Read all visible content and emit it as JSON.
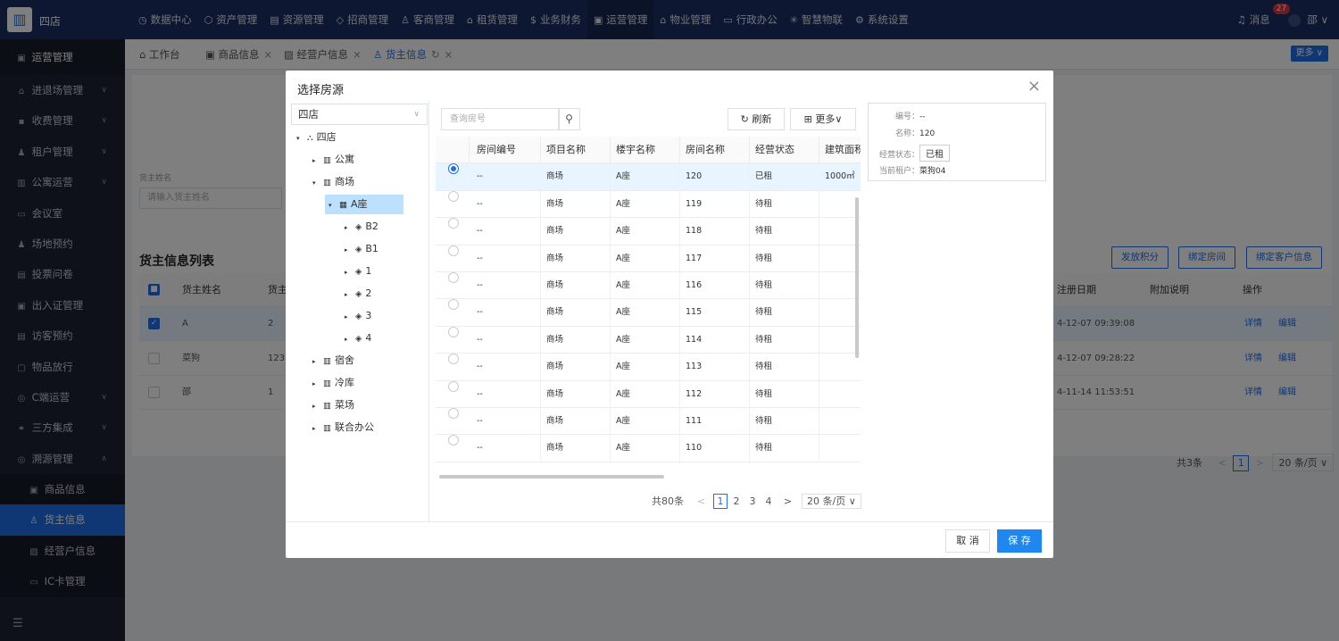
{
  "app": {
    "name": "四店",
    "logo_icon": "building-icon"
  },
  "topnav": [
    {
      "icon": "◷",
      "label": "数据中心",
      "active": false
    },
    {
      "icon": "⬡",
      "label": "资产管理",
      "active": false
    },
    {
      "icon": "▤",
      "label": "资源管理",
      "active": false
    },
    {
      "icon": "◇",
      "label": "招商管理",
      "active": false
    },
    {
      "icon": "♙",
      "label": "客商管理",
      "active": false
    },
    {
      "icon": "⌂",
      "label": "租赁管理",
      "active": false
    },
    {
      "icon": "$",
      "label": "业务财务",
      "active": false
    },
    {
      "icon": "▣",
      "label": "运营管理",
      "active": true
    },
    {
      "icon": "⌂",
      "label": "物业管理",
      "active": false
    },
    {
      "icon": "▭",
      "label": "行政办公",
      "active": false
    },
    {
      "icon": "✳",
      "label": "智慧物联",
      "active": false
    },
    {
      "icon": "⚙",
      "label": "系统设置",
      "active": false
    }
  ],
  "header": {
    "messages_label": "消息",
    "messages_count": "27",
    "user_name": "邵"
  },
  "sidebar": {
    "section_title": "运营管理",
    "items": [
      {
        "label": "进退场管理",
        "icon": "⌂",
        "has_arrow": true
      },
      {
        "label": "收费管理",
        "icon": "▪",
        "has_arrow": true
      },
      {
        "label": "租户管理",
        "icon": "♟",
        "has_arrow": true
      },
      {
        "label": "公寓运营",
        "icon": "▥",
        "has_arrow": true
      },
      {
        "label": "会议室",
        "icon": "▭",
        "has_arrow": false
      },
      {
        "label": "场地预约",
        "icon": "♟",
        "has_arrow": false
      },
      {
        "label": "投票问卷",
        "icon": "▤",
        "has_arrow": false
      },
      {
        "label": "出入证管理",
        "icon": "▣",
        "has_arrow": false
      },
      {
        "label": "访客预约",
        "icon": "▤",
        "has_arrow": false
      },
      {
        "label": "物品放行",
        "icon": "▢",
        "has_arrow": false
      },
      {
        "label": "C端运营",
        "icon": "◎",
        "has_arrow": true
      },
      {
        "label": "三方集成",
        "icon": "⚭",
        "has_arrow": true
      },
      {
        "label": "溯源管理",
        "icon": "◎",
        "has_arrow": true,
        "expanded": true
      }
    ],
    "sub_items": [
      {
        "label": "商品信息",
        "icon": "▣",
        "selected": false
      },
      {
        "label": "货主信息",
        "icon": "♙",
        "selected": true
      },
      {
        "label": "经营户信息",
        "icon": "▨",
        "selected": false
      },
      {
        "label": "IC卡管理",
        "icon": "▭",
        "selected": false
      }
    ]
  },
  "tabs": [
    {
      "icon": "⌂",
      "label": "工作台",
      "closable": false,
      "active": false
    },
    {
      "icon": "▣",
      "label": "商品信息",
      "closable": true,
      "active": false
    },
    {
      "icon": "▨",
      "label": "经营户信息",
      "closable": true,
      "active": false
    },
    {
      "icon": "♙",
      "label": "货主信息",
      "closable": true,
      "active": true,
      "refresh": "↻"
    }
  ],
  "tabs_more": "更多 ∨",
  "filter": {
    "label": "货主姓名",
    "placeholder": "请输入货主姓名"
  },
  "owner_list": {
    "title": "货主信息列表",
    "buttons": [
      "发放积分",
      "绑定房间",
      "绑定客户信息"
    ],
    "columns": [
      "货主姓名",
      "货主",
      "注册日期",
      "附加说明",
      "操作"
    ],
    "rows": [
      {
        "name": "A",
        "col2": "2",
        "date": "4-12-07 09:39:08",
        "selected": true
      },
      {
        "name": "菜狗",
        "col2": "123",
        "date": "4-12-07 09:28:22",
        "selected": false
      },
      {
        "name": "邵",
        "col2": "1",
        "date": "4-11-14 11:53:51",
        "selected": false
      }
    ],
    "action_detail": "详情",
    "action_edit": "编辑",
    "total": "共3条",
    "page": "1",
    "page_size": "20 条/页 ∨"
  },
  "modal": {
    "title": "选择房源",
    "tree_select": "四店",
    "tree": [
      {
        "label": "四店",
        "level": 0,
        "caret": "▾",
        "icon": "⛬",
        "selected": false
      },
      {
        "label": "公寓",
        "level": 1,
        "caret": "▸",
        "icon": "▥",
        "selected": false
      },
      {
        "label": "商场",
        "level": 1,
        "caret": "▾",
        "icon": "▥",
        "selected": false
      },
      {
        "label": "A座",
        "level": 2,
        "caret": "▾",
        "icon": "▦",
        "selected": true
      },
      {
        "label": "B2",
        "level": 3,
        "caret": "▸",
        "icon": "◈",
        "selected": false
      },
      {
        "label": "B1",
        "level": 3,
        "caret": "▸",
        "icon": "◈",
        "selected": false
      },
      {
        "label": "1",
        "level": 3,
        "caret": "▸",
        "icon": "◈",
        "selected": false
      },
      {
        "label": "2",
        "level": 3,
        "caret": "▸",
        "icon": "◈",
        "selected": false
      },
      {
        "label": "3",
        "level": 3,
        "caret": "▸",
        "icon": "◈",
        "selected": false
      },
      {
        "label": "4",
        "level": 3,
        "caret": "▸",
        "icon": "◈",
        "selected": false
      },
      {
        "label": "宿舍",
        "level": 1,
        "caret": "▸",
        "icon": "▥",
        "selected": false
      },
      {
        "label": "冷库",
        "level": 1,
        "caret": "▸",
        "icon": "▥",
        "selected": false
      },
      {
        "label": "菜场",
        "level": 1,
        "caret": "▸",
        "icon": "▥",
        "selected": false
      },
      {
        "label": "联合办公",
        "level": 1,
        "caret": "▸",
        "icon": "▥",
        "selected": false
      }
    ],
    "search_placeholder": "查询房号",
    "refresh_label": "刷新",
    "more_label": "更多",
    "columns": [
      "房间编号",
      "项目名称",
      "楼宇名称",
      "房间名称",
      "经营状态",
      "建筑面积"
    ],
    "rows": [
      {
        "code": "--",
        "project": "商场",
        "building": "A座",
        "room": "120",
        "status": "已租",
        "area": "1000㎡",
        "selected": true
      },
      {
        "code": "--",
        "project": "商场",
        "building": "A座",
        "room": "119",
        "status": "待租",
        "area": "",
        "selected": false
      },
      {
        "code": "--",
        "project": "商场",
        "building": "A座",
        "room": "118",
        "status": "待租",
        "area": "",
        "selected": false
      },
      {
        "code": "--",
        "project": "商场",
        "building": "A座",
        "room": "117",
        "status": "待租",
        "area": "",
        "selected": false
      },
      {
        "code": "--",
        "project": "商场",
        "building": "A座",
        "room": "116",
        "status": "待租",
        "area": "",
        "selected": false
      },
      {
        "code": "--",
        "project": "商场",
        "building": "A座",
        "room": "115",
        "status": "待租",
        "area": "",
        "selected": false
      },
      {
        "code": "--",
        "project": "商场",
        "building": "A座",
        "room": "114",
        "status": "待租",
        "area": "",
        "selected": false
      },
      {
        "code": "--",
        "project": "商场",
        "building": "A座",
        "room": "113",
        "status": "待租",
        "area": "",
        "selected": false
      },
      {
        "code": "--",
        "project": "商场",
        "building": "A座",
        "room": "112",
        "status": "待租",
        "area": "",
        "selected": false
      },
      {
        "code": "--",
        "project": "商场",
        "building": "A座",
        "room": "111",
        "status": "待租",
        "area": "",
        "selected": false
      },
      {
        "code": "--",
        "project": "商场",
        "building": "A座",
        "room": "110",
        "status": "待租",
        "area": "",
        "selected": false
      }
    ],
    "pager": {
      "total": "共80条",
      "prev": "<",
      "pages": [
        "1",
        "2",
        "3",
        "4"
      ],
      "current": "1",
      "next": ">",
      "size": "20 条/页 ∨"
    },
    "info": {
      "code_label": "编号：",
      "code_value": "--",
      "name_label": "名称：",
      "name_value": "120",
      "status_label": "经营状态：",
      "status_value": "已租",
      "tenant_label": "当前租户：",
      "tenant_value": "菜狗04"
    },
    "cancel": "取 消",
    "save": "保 存"
  },
  "colors": {
    "topbar": "#1b2f65",
    "sidebar": "#1c2232",
    "primary": "#1f6fe6",
    "selected_tree": "#bde0ff",
    "save_button": "#1f87f0"
  }
}
